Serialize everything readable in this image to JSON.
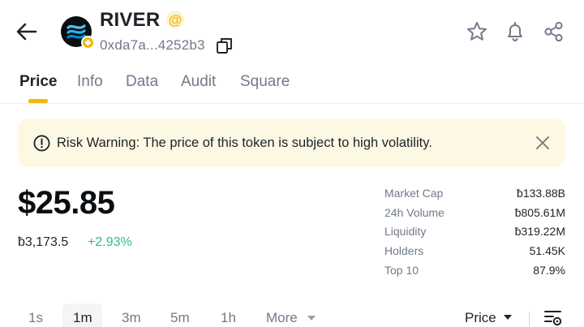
{
  "header": {
    "token_name": "RIVER",
    "at_badge": "@",
    "address": "0xda7a...4252b3",
    "icons": {
      "back": "arrow-left-icon",
      "copy": "copy-icon",
      "favorite": "star-icon",
      "alert": "bell-icon",
      "share": "share-icon"
    }
  },
  "tabs": [
    {
      "label": "Price",
      "active": true
    },
    {
      "label": "Info"
    },
    {
      "label": "Data"
    },
    {
      "label": "Audit"
    },
    {
      "label": "Square"
    }
  ],
  "warning": {
    "text": "Risk Warning: The price of this token is subject to high volatility."
  },
  "price": {
    "usd": "$25.85",
    "native": "ƀ3,173.5",
    "change": "+2.93%"
  },
  "stats": [
    {
      "label": "Market Cap",
      "value": "ƀ133.88B"
    },
    {
      "label": "24h Volume",
      "value": "ƀ805.61M"
    },
    {
      "label": "Liquidity",
      "value": "ƀ319.22M"
    },
    {
      "label": "Holders",
      "value": "51.45K"
    },
    {
      "label": "Top 10",
      "value": "87.9%"
    }
  ],
  "intervals": {
    "options": [
      "1s",
      "1m",
      "3m",
      "5m",
      "1h",
      "More"
    ],
    "selected": "1m",
    "chart_mode": "Price"
  },
  "colors": {
    "accent": "#f0b90b",
    "positive": "#2ebd85",
    "warning_bg": "#fdf8e3",
    "text_primary": "#1e2329",
    "text_secondary": "#707a8a"
  }
}
